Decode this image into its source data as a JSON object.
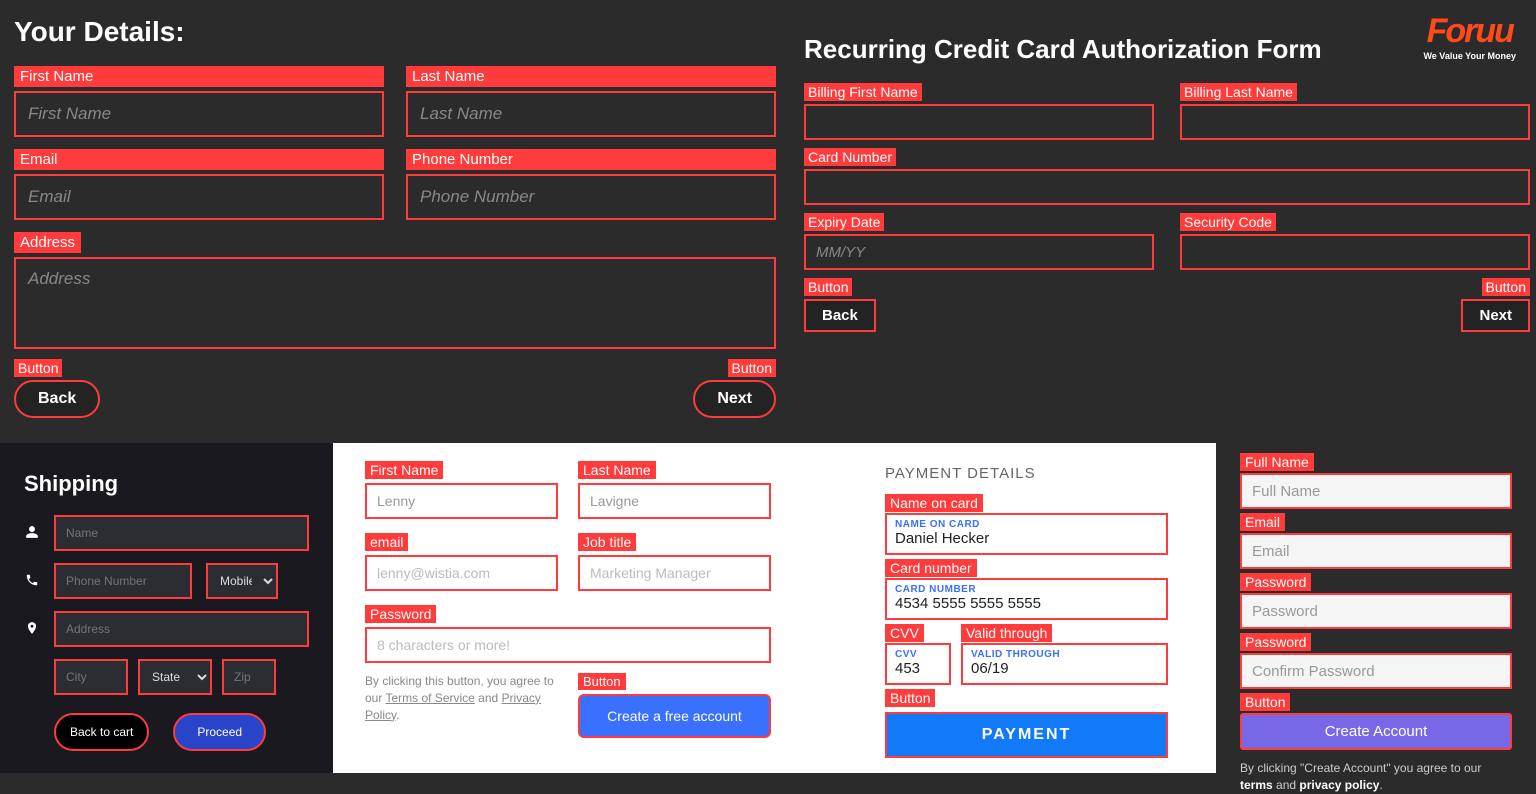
{
  "top_left": {
    "heading": "Your Details:",
    "fname_label": "First Name",
    "fname_ph": "First Name",
    "lname_label": "Last Name",
    "lname_ph": "Last Name",
    "email_label": "Email",
    "email_ph": "Email",
    "phone_label": "Phone Number",
    "phone_ph": "Phone Number",
    "address_label": "Address",
    "address_ph": "Address",
    "back_tag": "Button",
    "back_label": "Back",
    "next_tag": "Button",
    "next_label": "Next"
  },
  "top_right": {
    "logo_main": "Foruu",
    "logo_sub": "We Value Your Money",
    "heading": "Recurring Credit Card Authorization Form",
    "bfname_label": "Billing First Name",
    "blname_label": "Billing Last Name",
    "card_label": "Card Number",
    "exp_label": "Expiry Date",
    "exp_ph": "MM/YY",
    "sec_label": "Security Code",
    "back_tag": "Button",
    "back_label": "Back",
    "next_tag": "Button",
    "next_label": "Next"
  },
  "shipping": {
    "heading": "Shipping",
    "name_ph": "Name",
    "phone_ph": "Phone Number",
    "mobile_option": "Mobile",
    "address_ph": "Address",
    "city_ph": "City",
    "state_option": "State",
    "zip_ph": "Zip",
    "back_label": "Back to cart",
    "proceed_label": "Proceed"
  },
  "signup": {
    "fname_label": "First Name",
    "fname_val": "Lenny",
    "lname_label": "Last Name",
    "lname_val": "Lavigne",
    "email_label": "email",
    "email_ph": "lenny@wistia.com",
    "job_label": "Job title",
    "job_ph": "Marketing Manager",
    "pw_label": "Password",
    "pw_ph": "8 characters or more!",
    "terms1": "By clicking this button, you agree to our ",
    "terms_link1": "Terms of Service",
    "terms2": " and ",
    "terms_link2": "Privacy Policy",
    "terms3": ".",
    "btn_tag": "Button",
    "btn_label": "Create a free account"
  },
  "payment": {
    "heading": "PAYMENT DETAILS",
    "name_tag": "Name on card",
    "name_lab": "NAME ON CARD",
    "name_val": "Daniel Hecker",
    "card_tag": "Card number",
    "card_lab": "CARD NUMBER",
    "card_val": "4534 5555 5555 5555",
    "cvv_tag": "CVV",
    "cvv_lab": "CVV",
    "cvv_val": "453",
    "vt_tag": "Valid through",
    "vt_lab": "VALID THROUGH",
    "vt_val": "06/19",
    "btn_tag": "Button",
    "btn_label": "PAYMENT"
  },
  "create": {
    "fullname_label": "Full Name",
    "fullname_ph": "Full Name",
    "email_label": "Email",
    "email_ph": "Email",
    "pw_label": "Password",
    "pw_ph": "Password",
    "cpw_label": "Password",
    "cpw_ph": "Confirm Password",
    "btn_tag": "Button",
    "btn_label": "Create Account",
    "terms1": "By clicking \"Create Account\" you agree to our ",
    "terms_b1": "terms",
    "terms2": " and ",
    "terms_b2": "privacy policy",
    "terms3": "."
  }
}
